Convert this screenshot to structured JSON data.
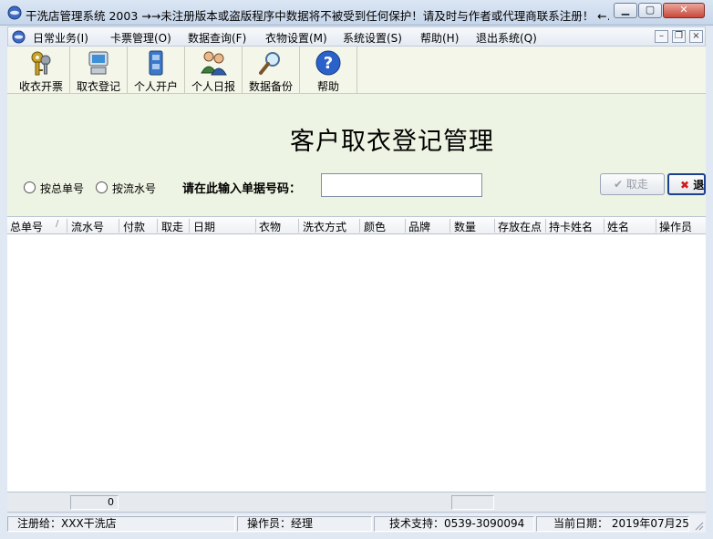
{
  "window": {
    "title": "干洗店管理系统 2003 →→未注册版本或盗版程序中数据将不被受到任何保护！请及时与作者或代理商联系注册！ ←…"
  },
  "menu": {
    "items": [
      {
        "label": "日常业务(I)"
      },
      {
        "label": "卡票管理(O)"
      },
      {
        "label": "数据查询(F)"
      },
      {
        "label": "衣物设置(M)"
      },
      {
        "label": "系统设置(S)"
      },
      {
        "label": "帮助(H)"
      },
      {
        "label": "退出系统(Q)"
      }
    ]
  },
  "toolbar": {
    "items": [
      {
        "label": "收衣开票",
        "icon": "keys-icon"
      },
      {
        "label": "取衣登记",
        "icon": "computer-icon"
      },
      {
        "label": "个人开户",
        "icon": "cabinet-icon"
      },
      {
        "label": "个人日报",
        "icon": "people-icon"
      },
      {
        "label": "数据备份",
        "icon": "magnifier-icon"
      },
      {
        "label": "帮助",
        "icon": "help-icon"
      }
    ]
  },
  "panel": {
    "title": "客户取衣登记管理",
    "radio_by_order": "按总单号",
    "radio_by_serial": "按流水号",
    "input_prompt": "请在此输入单据号码：",
    "input_value": "",
    "pickup_button": "取走",
    "exit_button": "退"
  },
  "grid": {
    "columns": [
      "总单号",
      "流水号",
      "付款",
      "取走",
      "日期",
      "衣物",
      "洗衣方式",
      "颜色",
      "品牌",
      "数量",
      "存放在点",
      "持卡姓名",
      "姓名",
      "操作员"
    ],
    "sort_indicator": "/",
    "rows": []
  },
  "totals": {
    "count": "0",
    "sum": ""
  },
  "status": {
    "registered_to": "注册给：XXX干洗店",
    "operator": "操作员：经理",
    "support": "技术支持：0539-3090094",
    "current_date": "当前日期： 2019年07月25日"
  },
  "colors": {
    "panel_bg": "#eef4e3",
    "toolbar_bg": "#f3f6e9",
    "close_red": "#c9483a",
    "exit_x_red": "#d11a1a"
  }
}
